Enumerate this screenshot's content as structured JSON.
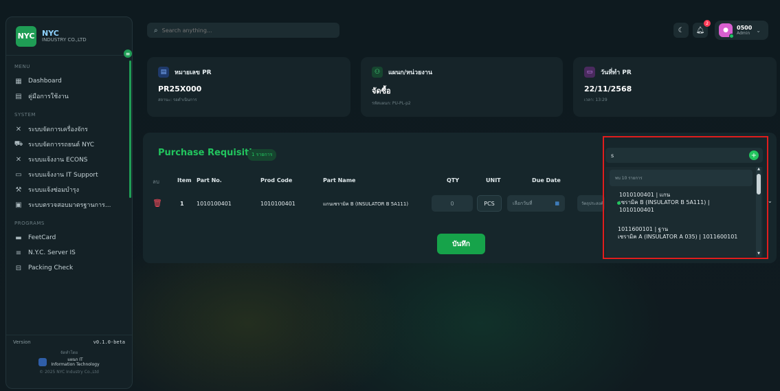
{
  "brand": {
    "logo": "NYC",
    "name": "NYC",
    "subtitle": "INDUSTRY CO.,LTD"
  },
  "sidebar": {
    "menu_label": "MENU",
    "menu_items": [
      {
        "label": "Dashboard",
        "icon": "dashboard-icon"
      },
      {
        "label": "คู่มือการใช้งาน",
        "icon": "book-icon"
      }
    ],
    "system_label": "SYSTEM",
    "system_items": [
      {
        "label": "ระบบจัดการเครื่องจักร",
        "icon": "tools-icon"
      },
      {
        "label": "ระบบจัดการรถยนต์ NYC",
        "icon": "car-icon"
      },
      {
        "label": "ระบบแจ้งงาน ECONS",
        "icon": "tools-icon"
      },
      {
        "label": "ระบบแจ้งงาน IT Support",
        "icon": "monitor-icon"
      },
      {
        "label": "ระบบแจ้งซ่อมบำรุง",
        "icon": "wrench-icon"
      },
      {
        "label": "ระบบตรวจสอบมาตรฐานการ...",
        "icon": "clipboard-icon"
      }
    ],
    "programs_label": "PROGRAMS",
    "program_items": [
      {
        "label": "FeetCard",
        "icon": "card-icon"
      },
      {
        "label": "N.Y.C. Server IS",
        "icon": "server-icon"
      },
      {
        "label": "Packing Check",
        "icon": "box-icon"
      }
    ],
    "footer": {
      "version_label": "Version",
      "version": "v0.1.0-beta",
      "developed_by": "จัดทำโดย",
      "dept_name": "แผนก IT",
      "dept_sub": "Information Technology",
      "copyright": "© 2025 NYC Industry Co.,Ltd"
    }
  },
  "header": {
    "search_placeholder": "Search anything...",
    "notification_count": "2",
    "user": {
      "id": "0500",
      "role": "Admin"
    }
  },
  "cards": [
    {
      "title": "หมายเลข PR",
      "value": "PR25X000",
      "sub": "สถานะ: รอดำเนินการ",
      "icon": "document-icon",
      "accent": "#3b6fd8"
    },
    {
      "title": "แผนก/หน่วยงาน",
      "value": "จัดซื้อ",
      "sub": "รหัสแผนก: PU-PL-p2",
      "icon": "users-icon",
      "accent": "#22c55e"
    },
    {
      "title": "วันที่ทำ PR",
      "value": "22/11/2568",
      "sub": "เวลา: 13:29",
      "icon": "calendar-icon",
      "accent": "#b65be0"
    }
  ],
  "pr": {
    "title": "Purchase Requisition",
    "count_badge": "1 รายการ",
    "columns": {
      "del": "ลบ",
      "item": "Item",
      "part_no": "Part No.",
      "prod_code": "Prod Code",
      "part_name": "Part Name",
      "qty": "QTY",
      "unit": "UNIT",
      "due_date": "Due Date"
    },
    "row": {
      "item": "1",
      "part_no": "1010100401",
      "prod_code": "1010100401",
      "part_name": "แกนเซรามิค B (INSULATOR B 5A111)",
      "qty": "0",
      "unit": "PCS",
      "due_date_placeholder": "เลือกวันที่",
      "purpose_placeholder": "วัตถุประสงค์"
    },
    "save_label": "บันทึก"
  },
  "dropdown": {
    "query": "s",
    "result_header": "พบ 10 รายการ",
    "options": [
      {
        "line1": "1010100401 | แกน",
        "line2": "เซรามิค B (INSULATOR B 5A111) |",
        "line3": "1010100401"
      },
      {
        "line1": "1011600101 | ฐาน",
        "line2": "เซรามิค A (INSULATOR A 035) | 1011600101"
      }
    ]
  }
}
